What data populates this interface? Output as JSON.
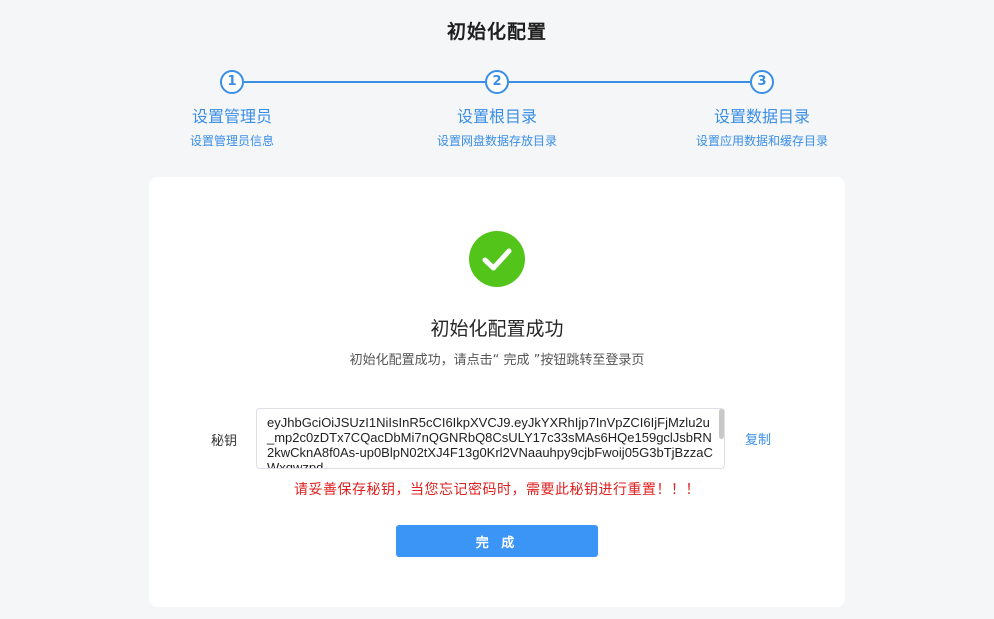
{
  "page": {
    "title": "初始化配置"
  },
  "steps": [
    {
      "number": "1",
      "title": "设置管理员",
      "desc": "设置管理员信息"
    },
    {
      "number": "2",
      "title": "设置根目录",
      "desc": "设置网盘数据存放目录"
    },
    {
      "number": "3",
      "title": "设置数据目录",
      "desc": "设置应用数据和缓存目录"
    }
  ],
  "result": {
    "icon": "check-circle-icon",
    "title": "初始化配置成功",
    "subtitle": "初始化配置成功，请点击“ 完成 ”按钮跳转至登录页"
  },
  "secret": {
    "label": "秘钥",
    "value": "eyJhbGciOiJSUzI1NiIsInR5cCI6IkpXVCJ9.eyJkYXRhIjp7InVpZCI6IjFjMzlu2u_mp2c0zDTx7CQacDbMi7nQGNRbQ8CsULY17c33sMAs6HQe159gclJsbRN2kwCknA8f0As-up0BlpN02tXJ4F13g0Krl2VNaauhpy9cjbFwoij05G3bTjBzzaCWxqwzpd",
    "copy_label": "复制",
    "warning": "请妥善保存秘钥，当您忘记密码时，需要此秘钥进行重置！！！"
  },
  "actions": {
    "done_label": "完 成"
  },
  "colors": {
    "primary": "#3a8ee6",
    "success": "#52c41a",
    "danger": "#e02020",
    "background": "#f5f6f8"
  }
}
